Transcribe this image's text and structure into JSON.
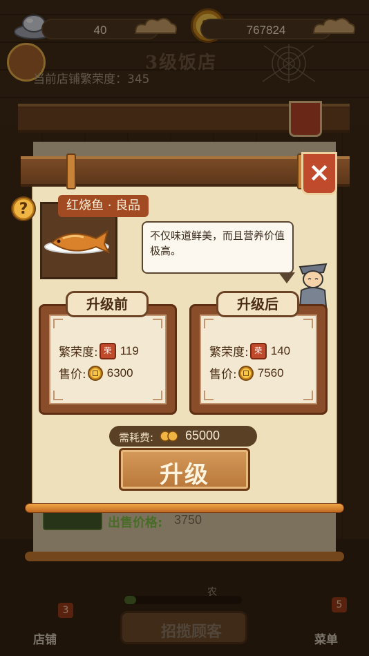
{
  "resources": {
    "silver": "40",
    "coins": "767824"
  },
  "shop": {
    "level_title": "3级饭店",
    "prosperity_text": "当前店铺繁荣度：345"
  },
  "dish": {
    "title": "红烧鱼 · 良品",
    "description": "不仅味道鲜美，而且营养价值极高。"
  },
  "before": {
    "tab": "升级前",
    "prosperity_label": "繁荣度:",
    "prosperity_value": "119",
    "price_label": "售价:",
    "price_value": "6300"
  },
  "after": {
    "tab": "升级后",
    "prosperity_label": "繁荣度:",
    "prosperity_value": "140",
    "price_label": "售价:",
    "price_value": "7560"
  },
  "cost": {
    "label": "需耗费:",
    "value": "65000"
  },
  "upgrade_label": "升级",
  "close_label": "×",
  "help_label": "?",
  "flag_glyph": "荣",
  "background": {
    "sell_label": "出售价格:",
    "sell_value": "3750",
    "farm_tag": "农",
    "attract_label": "招揽顾客",
    "store_label": "店铺",
    "store_badge": "3",
    "menu_label": "菜单",
    "menu_badge": "5",
    "progress": 0.1
  },
  "icons": {
    "silver": "silver-ingot-icon",
    "coin": "copper-coin-icon",
    "flag": "prosperity-flag-icon",
    "help": "question-icon",
    "close": "close-icon",
    "chef": "chef-icon",
    "dish": "braised-fish-icon"
  },
  "colors": {
    "accent": "#c04a2c",
    "panel": "#efe0bc",
    "frame": "#8a4d2a"
  }
}
